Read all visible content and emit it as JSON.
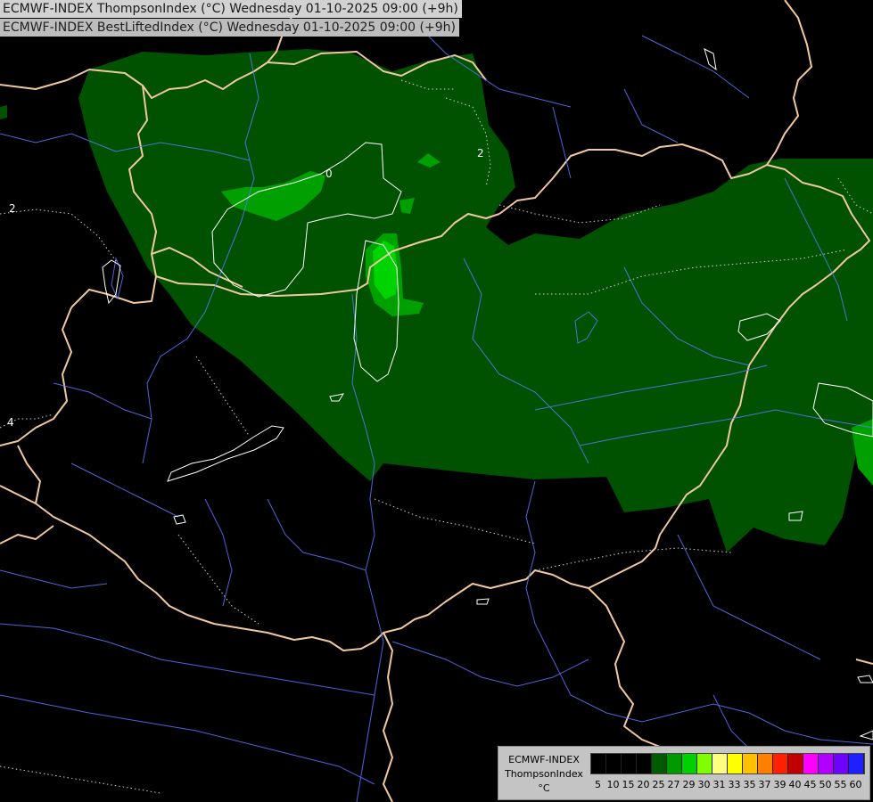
{
  "titles": [
    "ECMWF-INDEX ThompsonIndex (°C) Wednesday 01-10-2025 09:00 (+9h)",
    "ECMWF-INDEX BestLiftedIndex (°C) Wednesday 01-10-2025 09:00 (+9h)"
  ],
  "legend": {
    "model": "ECMWF-INDEX",
    "parameter": "ThompsonIndex",
    "unit": "°C",
    "ticks": [
      "5",
      "10",
      "15",
      "20",
      "25",
      "27",
      "29",
      "30",
      "31",
      "33",
      "35",
      "37",
      "39",
      "40",
      "45",
      "50",
      "55",
      "60"
    ],
    "colors": [
      "#000000",
      "#000000",
      "#000000",
      "#000000",
      "#005a00",
      "#009900",
      "#00d000",
      "#7fff00",
      "#ffff7f",
      "#ffff00",
      "#ffc000",
      "#ff8000",
      "#ff2000",
      "#c00000",
      "#ff00ff",
      "#b000ff",
      "#7000ff",
      "#2020ff"
    ]
  },
  "colors": {
    "background": "#000000",
    "thompson_25": "#005200",
    "thompson_27": "#00a000",
    "thompson_29": "#00e000",
    "borders": "#f0c8a0",
    "rivers": "#5a78ff",
    "contours_lifted": "#ffffff"
  },
  "contour_labels": [
    "0",
    "2",
    "2",
    "4"
  ]
}
